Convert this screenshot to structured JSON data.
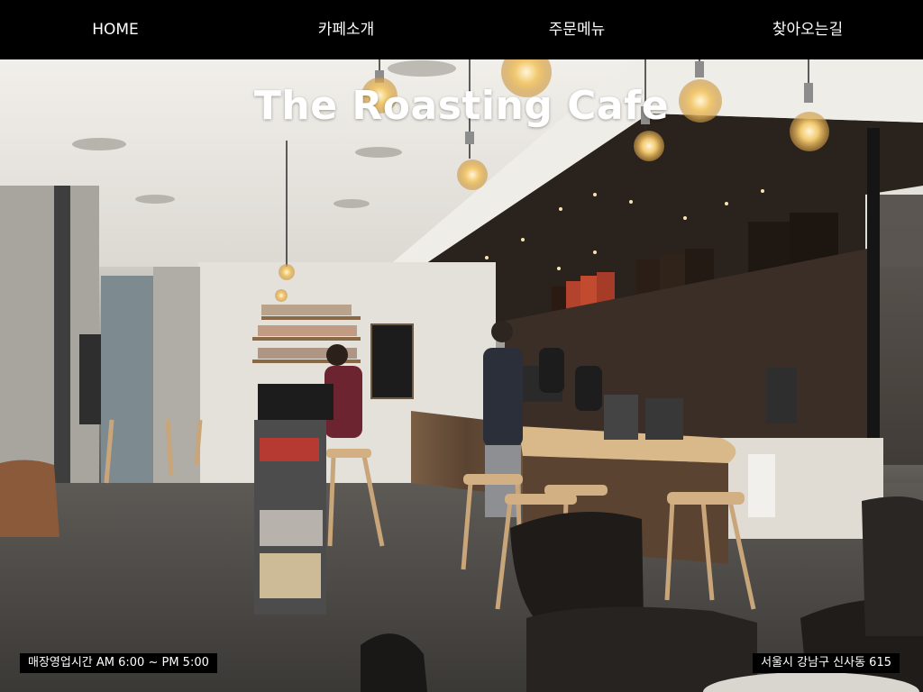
{
  "nav": {
    "items": [
      {
        "label": "HOME"
      },
      {
        "label": "카페소개"
      },
      {
        "label": "주문메뉴"
      },
      {
        "label": "찾아오는길"
      }
    ]
  },
  "hero": {
    "title": "The Roasting Cafe",
    "hours": "매장영업시간 AM 6:00 ~ PM 5:00",
    "address": "서울시 강남구 신사동 615"
  },
  "colors": {
    "nav_background": "#000000",
    "nav_text": "#ffffff",
    "label_background": "#000000"
  }
}
